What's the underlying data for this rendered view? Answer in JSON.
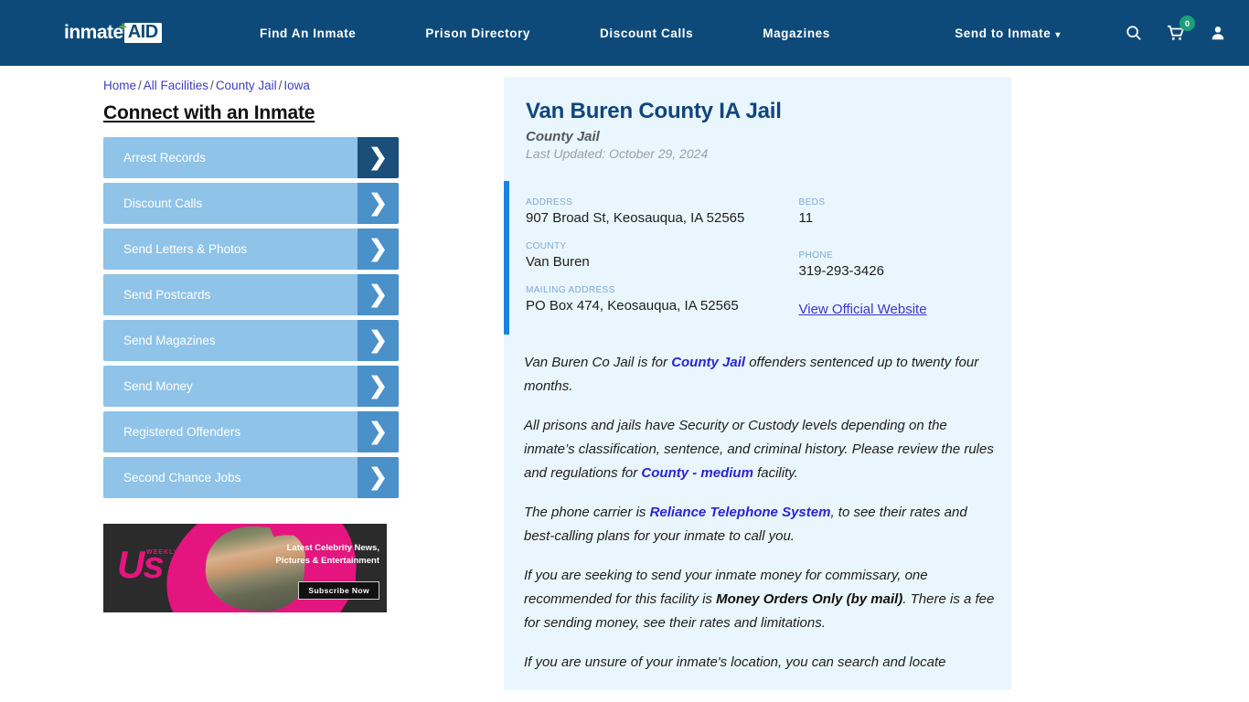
{
  "header": {
    "logo": {
      "word": "inmate",
      "badge": "AID",
      "plus": "+"
    },
    "nav": [
      {
        "label": "Find An Inmate"
      },
      {
        "label": "Prison Directory"
      },
      {
        "label": "Discount Calls"
      },
      {
        "label": "Magazines"
      }
    ],
    "dropdown": {
      "label": "Send to Inmate",
      "caret": "▾"
    },
    "icons": {
      "search": "search-icon",
      "cart": "cart-icon",
      "account": "user-icon"
    },
    "cart_count": "0",
    "colors": {
      "nav_bg": "#0d4a7a",
      "badge_green": "#1aa179"
    }
  },
  "breadcrumb": {
    "items": [
      "Home",
      "All Facilities",
      "County Jail",
      "Iowa"
    ],
    "separator": "/"
  },
  "sidebar": {
    "title": "Connect with an Inmate",
    "items": [
      {
        "label": "Arrest Records",
        "active": true
      },
      {
        "label": "Discount Calls",
        "active": false
      },
      {
        "label": "Send Letters & Photos",
        "active": false
      },
      {
        "label": "Send Postcards",
        "active": false
      },
      {
        "label": "Send Magazines",
        "active": false
      },
      {
        "label": "Send Money",
        "active": false
      },
      {
        "label": "Registered Offenders",
        "active": false
      },
      {
        "label": "Second Chance Jobs",
        "active": false
      }
    ],
    "chevron": "❯"
  },
  "ad": {
    "brand": "Us",
    "brand_dots": "WEEKLY",
    "headline": "Latest Celebrity News, Pictures & Entertainment",
    "cta": "Subscribe Now"
  },
  "facility": {
    "title": "Van Buren County IA Jail",
    "type": "County Jail",
    "last_updated": "Last Updated: October 29, 2024",
    "fields": {
      "address_label": "ADDRESS",
      "address_value": "907 Broad St, Keosauqua, IA 52565",
      "county_label": "COUNTY",
      "county_value": "Van Buren",
      "mailing_label": "MAILING ADDRESS",
      "mailing_value": "PO Box 474, Keosauqua, IA 52565",
      "beds_label": "BEDS",
      "beds_value": "11",
      "phone_label": "PHONE",
      "phone_value": "319-293-3426",
      "website_link": "View Official Website"
    }
  },
  "body": {
    "p1_a": "Van Buren Co Jail is for ",
    "p1_link": "County Jail",
    "p1_b": " offenders sentenced up to twenty four months.",
    "p2_a": "All prisons and jails have Security or Custody levels depending on the inmate’s classification, sentence, and criminal history. Please review the rules and regulations for ",
    "p2_link": "County - medium",
    "p2_b": " facility.",
    "p3_a": "The phone carrier is ",
    "p3_link": "Reliance Telephone System",
    "p3_b": ", to see their rates and best-calling plans for your inmate to call you.",
    "p4_a": "If you are seeking to send your inmate money for commissary, one recommended for this facility is ",
    "p4_bold": "Money Orders Only (by mail)",
    "p4_b": ". There is a fee for sending money, see their rates and limitations.",
    "p5": "If you are unsure of your inmate's location, you can search and locate"
  }
}
